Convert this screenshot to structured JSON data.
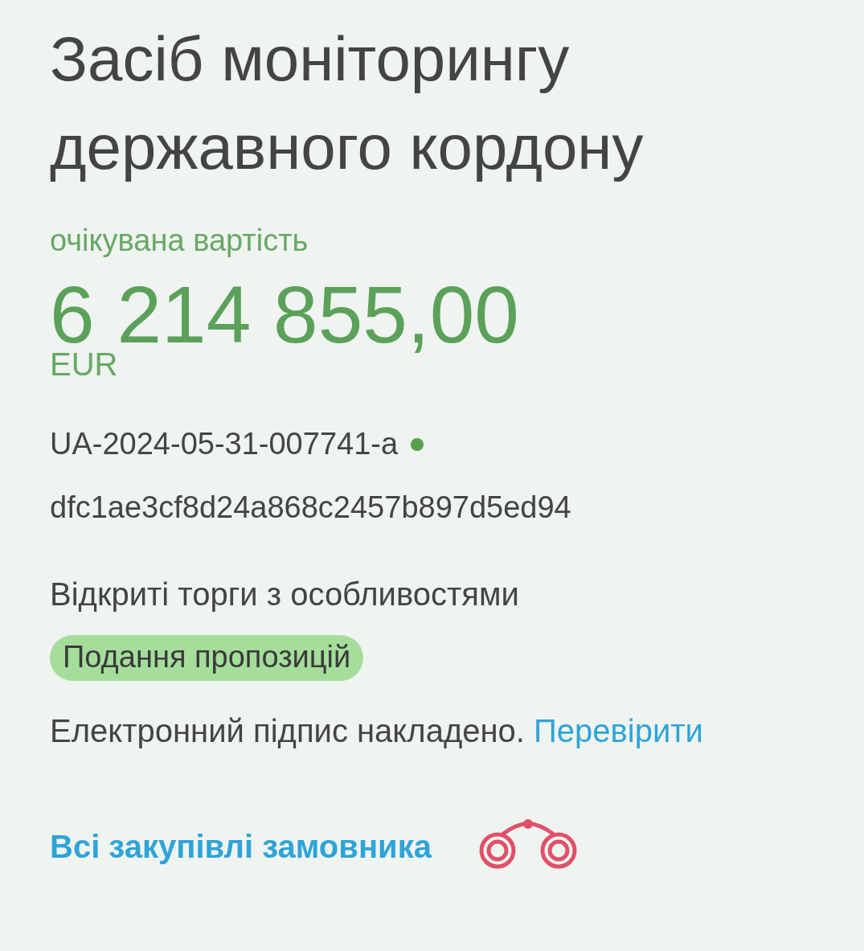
{
  "title": "Засіб моніторингу державного кордону",
  "expected_value": {
    "label": "очікувана вартість",
    "amount": "6 214 855,00",
    "currency": "EUR"
  },
  "tender_id": {
    "text": "UA-2024-05-31-007741-a",
    "status_dot": {
      "color": "#5a9e4f"
    }
  },
  "hash": "dfc1ae3cf8d24a868c2457b897d5ed94",
  "procedure_type": "Відкриті торги з особливостями",
  "status_badge": "Подання пропозицій",
  "signature": {
    "text": "Електронний підпис накладено.",
    "link": "Перевірити"
  },
  "buyer_link": {
    "text": "Всі закупівлі замовника"
  }
}
